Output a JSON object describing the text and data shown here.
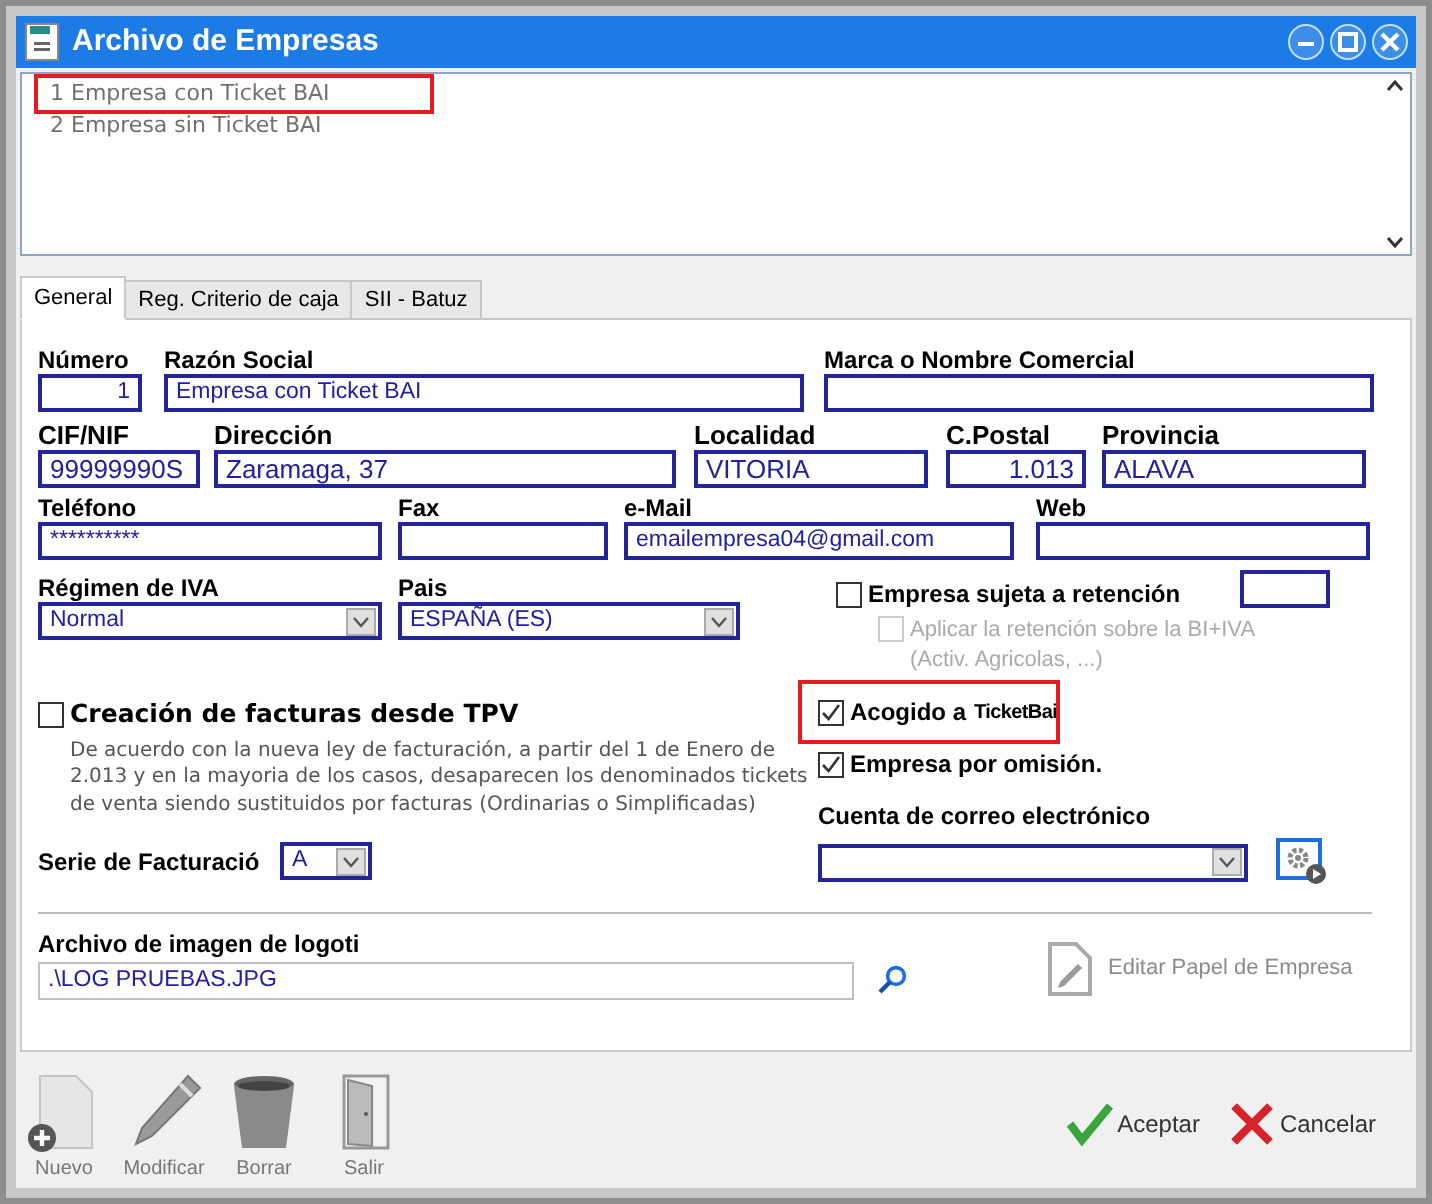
{
  "window": {
    "title": "Archivo de Empresas"
  },
  "company_list": {
    "items": [
      {
        "label": "1 Empresa con Ticket BAI",
        "highlighted": true
      },
      {
        "label": "2 Empresa sin Ticket BAI",
        "highlighted": false
      }
    ]
  },
  "tabs": [
    {
      "label": "General",
      "selected": true
    },
    {
      "label": "Reg. Criterio de caja",
      "selected": false
    },
    {
      "label": "SII - Batuz",
      "selected": false
    }
  ],
  "numero": {
    "label": "Número",
    "value": "1"
  },
  "razon_social": {
    "label": "Razón Social",
    "value": "Empresa con Ticket BAI"
  },
  "marca": {
    "label": "Marca o Nombre Comercial"
  },
  "cif_nif": {
    "label": "CIF/NIF",
    "value": "99999990S"
  },
  "direccion": {
    "label": "Dirección",
    "value": "Zaramaga, 37"
  },
  "localidad": {
    "label": "Localidad",
    "value": "VITORIA"
  },
  "c_postal": {
    "label": "C.Postal",
    "value": "1.013"
  },
  "provincia": {
    "label": "Provincia",
    "value": "ALAVA"
  },
  "telefono": {
    "label": "Teléfono",
    "value": "**********"
  },
  "fax": {
    "label": "Fax"
  },
  "email": {
    "label": "e-Mail",
    "value": "emailempresa04@gmail.com"
  },
  "web": {
    "label": "Web"
  },
  "regimen_iva": {
    "label": "Régimen de IVA",
    "value": "Normal"
  },
  "pais": {
    "label": "Pais",
    "value": "ESPAÑA  (ES)"
  },
  "retencion": {
    "label": "Empresa sujeta a retención",
    "checked": false
  },
  "aplicar_retencion": {
    "label": "Aplicar la retención sobre la BI+IVA (Activ. Agricolas, ...)",
    "checked": false,
    "disabled": true
  },
  "tpv": {
    "label": "Creación de facturas desde TPV",
    "checked": false,
    "description": "De acuerdo con la nueva ley de facturación, a partir del 1 de Enero de 2.013 y en la mayoria de los casos, desaparecen los denominados tickets de venta siendo sustituidos por facturas (Ordinarias o Simplificadas)"
  },
  "acogido": {
    "label": "Acogido a",
    "brand": "TicketBai",
    "checked": true,
    "highlighted": true
  },
  "por_omision": {
    "label": "Empresa por omisión.",
    "checked": true
  },
  "cuenta_correo": {
    "label": "Cuenta de correo electrónico"
  },
  "serie": {
    "label": "Serie de Facturació",
    "value": "A"
  },
  "logo": {
    "label": "Archivo de imagen de logoti",
    "value": ".\\LOG  PRUEBAS.JPG"
  },
  "editar_papel": {
    "label": "Editar Papel de Empresa",
    "disabled": true
  },
  "toolbar": [
    {
      "label": "Nuevo",
      "kind": "new"
    },
    {
      "label": "Modificar",
      "kind": "edit"
    },
    {
      "label": "Borrar",
      "kind": "delete"
    },
    {
      "label": "Salir",
      "kind": "exit"
    }
  ],
  "actions": [
    {
      "label": "Aceptar",
      "kind": "ok"
    },
    {
      "label": "Cancelar",
      "kind": "cancel"
    }
  ]
}
